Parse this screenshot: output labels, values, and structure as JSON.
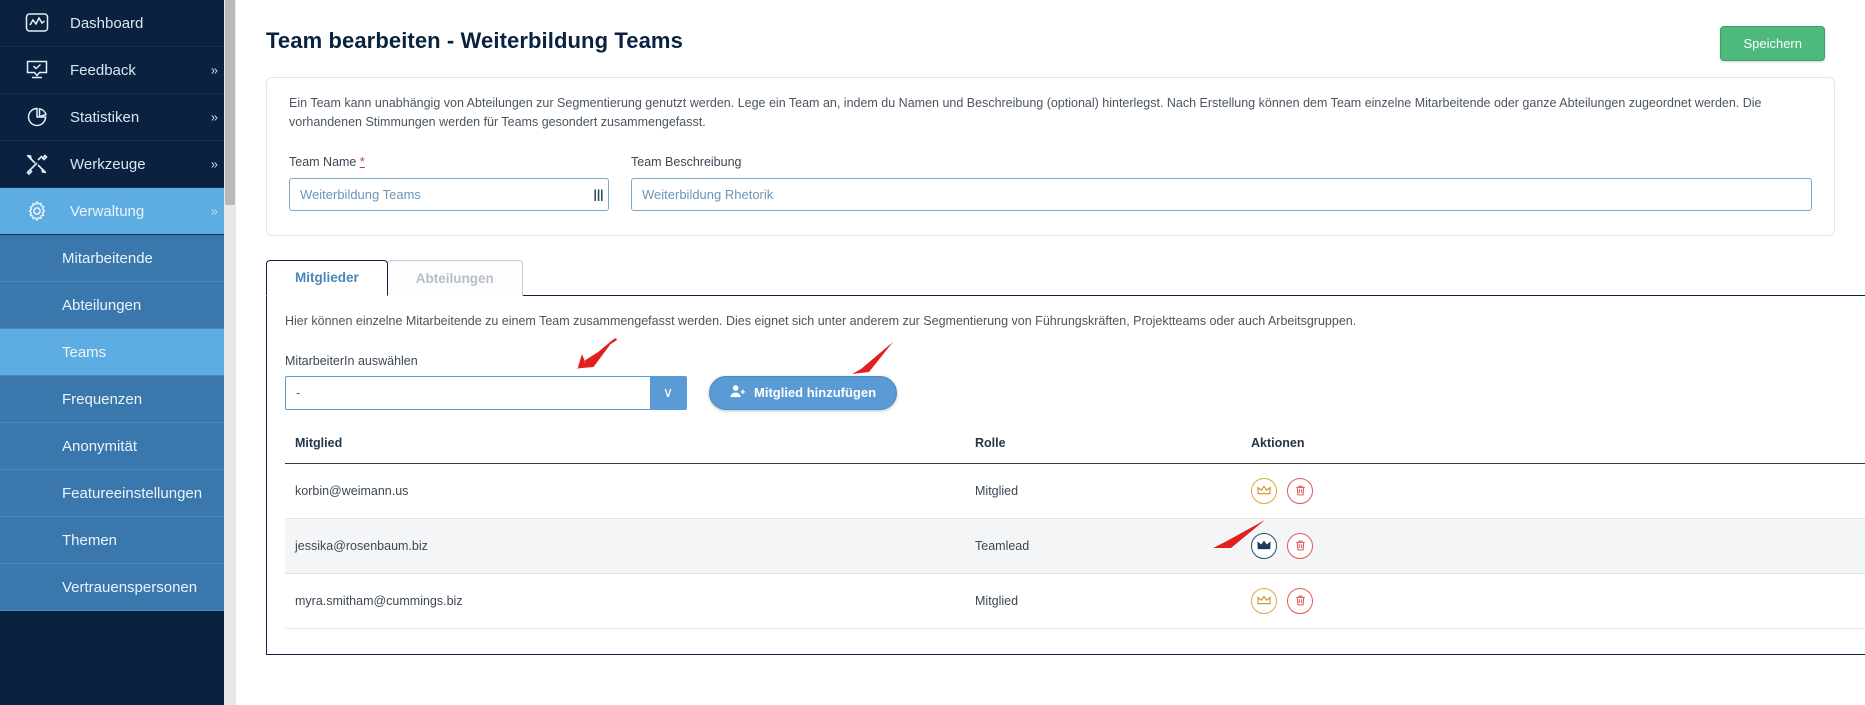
{
  "sidebar": {
    "items": [
      {
        "label": "Dashboard",
        "icon": "dashboard-icon",
        "expandable": false,
        "active": false
      },
      {
        "label": "Feedback",
        "icon": "feedback-icon",
        "expandable": true,
        "active": false
      },
      {
        "label": "Statistiken",
        "icon": "statistics-icon",
        "expandable": true,
        "active": false
      },
      {
        "label": "Werkzeuge",
        "icon": "tools-icon",
        "expandable": true,
        "active": false
      },
      {
        "label": "Verwaltung",
        "icon": "gear-icon",
        "expandable": true,
        "active": true
      }
    ],
    "subitems": [
      {
        "label": "Mitarbeitende",
        "active": false
      },
      {
        "label": "Abteilungen",
        "active": false
      },
      {
        "label": "Teams",
        "active": true
      },
      {
        "label": "Frequenzen",
        "active": false
      },
      {
        "label": "Anonymität",
        "active": false
      },
      {
        "label": "Featureeinstellungen",
        "active": false
      },
      {
        "label": "Themen",
        "active": false
      },
      {
        "label": "Vertrauenspersonen",
        "active": false
      }
    ],
    "chevron": "»"
  },
  "header": {
    "title": "Team bearbeiten - Weiterbildung Teams",
    "save_label": "Speichern"
  },
  "info_card": {
    "description": "Ein Team kann unabhängig von Abteilungen zur Segmentierung genutzt werden. Lege ein Team an, indem du Namen und Beschreibung (optional) hinterlegst. Nach Erstellung können dem Team einzelne Mitarbeitende oder ganze Abteilungen zugeordnet werden. Die vorhandenen Stimmungen werden für Teams gesondert zusammengefasst.",
    "team_name": {
      "label": "Team Name",
      "required_mark": "*",
      "value": "Weiterbildung Teams"
    },
    "team_description": {
      "label": "Team Beschreibung",
      "value": "Weiterbildung Rhetorik"
    }
  },
  "tabs": [
    {
      "label": "Mitglieder",
      "active": true
    },
    {
      "label": "Abteilungen",
      "active": false
    }
  ],
  "members_panel": {
    "description": "Hier können einzelne Mitarbeitende zu einem Team zusammengefasst werden. Dies eignet sich unter anderem zur Segmentierung von Führungskräften, Projektteams oder auch Arbeitsgruppen.",
    "picker_label": "MitarbeiterIn auswählen",
    "picker_value": "-",
    "picker_arrow": "∨",
    "add_button_label": "Mitglied hinzufügen",
    "add_button_icon": "add-person-icon",
    "columns": [
      "Mitglied",
      "Rolle",
      "Aktionen"
    ],
    "rows": [
      {
        "mitglied": "korbin@weimann.us",
        "rolle": "Mitglied",
        "crown_icon": "crown-icon",
        "crown_active": false,
        "delete_icon": "trash-icon"
      },
      {
        "mitglied": "jessika@rosenbaum.biz",
        "rolle": "Teamlead",
        "crown_icon": "crown-icon",
        "crown_active": true,
        "delete_icon": "trash-icon"
      },
      {
        "mitglied": "myra.smitham@cummings.biz",
        "rolle": "Mitglied",
        "crown_icon": "crown-icon",
        "crown_active": false,
        "delete_icon": "trash-icon"
      }
    ]
  },
  "annotations": {
    "color": "#e02020",
    "arrows": [
      {
        "name": "arrow-to-member-select"
      },
      {
        "name": "arrow-to-add-member-button"
      },
      {
        "name": "arrow-to-teamlead-crown"
      }
    ]
  }
}
